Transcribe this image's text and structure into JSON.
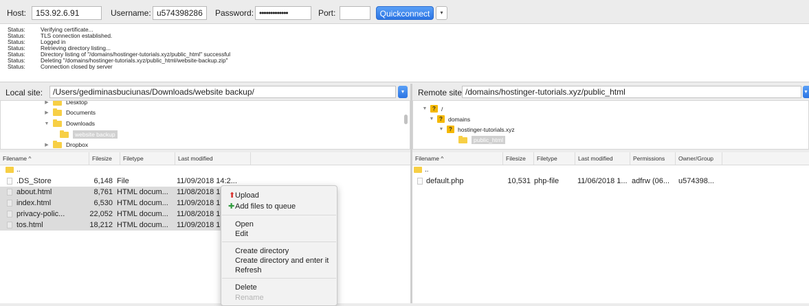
{
  "quickconnect": {
    "host_label": "Host:",
    "host_value": "153.92.6.91",
    "username_label": "Username:",
    "username_value": "u574398286",
    "password_label": "Password:",
    "password_value": "•••••••••••••",
    "port_label": "Port:",
    "port_value": "",
    "button_label": "Quickconnect",
    "dropdown_icon": "▾"
  },
  "log": [
    {
      "label": "Status:",
      "text": "Verifying certificate..."
    },
    {
      "label": "Status:",
      "text": "TLS connection established."
    },
    {
      "label": "Status:",
      "text": "Logged in"
    },
    {
      "label": "Status:",
      "text": "Retrieving directory listing..."
    },
    {
      "label": "Status:",
      "text": "Directory listing of \"/domains/hostinger-tutorials.xyz/public_html\" successful"
    },
    {
      "label": "Status:",
      "text": "Deleting \"/domains/hostinger-tutorials.xyz/public_html/website-backup.zip\""
    },
    {
      "label": "Status:",
      "text": "Connection closed by server"
    }
  ],
  "local": {
    "site_label": "Local site:",
    "site_path": "/Users/gediminasbuciunas/Downloads/website backup/",
    "tree": [
      {
        "label": "Desktop",
        "expanded": false
      },
      {
        "label": "Documents",
        "expanded": false
      },
      {
        "label": "Downloads",
        "expanded": true
      },
      {
        "label": "website backup",
        "expanded": false
      },
      {
        "label": "Dropbox",
        "expanded": false
      }
    ],
    "columns": {
      "filename": "Filename ^",
      "filesize": "Filesize",
      "filetype": "Filetype",
      "modified": "Last modified"
    },
    "parent": "..",
    "files": [
      {
        "name": ".DS_Store",
        "size": "6,148",
        "type": "File",
        "modified": "11/09/2018 14:2..."
      },
      {
        "name": "about.html",
        "size": "8,761",
        "type": "HTML docum...",
        "modified": "11/08/2018 19"
      },
      {
        "name": "index.html",
        "size": "6,530",
        "type": "HTML docum...",
        "modified": "11/09/2018 13"
      },
      {
        "name": "privacy-polic...",
        "size": "22,052",
        "type": "HTML docum...",
        "modified": "11/08/2018 19"
      },
      {
        "name": "tos.html",
        "size": "18,212",
        "type": "HTML docum...",
        "modified": "11/09/2018 13"
      }
    ]
  },
  "remote": {
    "site_label": "Remote site:",
    "site_path": "/domains/hostinger-tutorials.xyz/public_html",
    "tree": [
      {
        "label": "/"
      },
      {
        "label": "domains"
      },
      {
        "label": "hostinger-tutorials.xyz"
      },
      {
        "label": "public_html"
      }
    ],
    "columns": {
      "filename": "Filename ^",
      "filesize": "Filesize",
      "filetype": "Filetype",
      "modified": "Last modified",
      "permissions": "Permissions",
      "owner": "Owner/Group"
    },
    "parent": "..",
    "files": [
      {
        "name": "default.php",
        "size": "10,531",
        "type": "php-file",
        "modified": "11/06/2018 1...",
        "permissions": "adfrw (06...",
        "owner": "u574398..."
      }
    ]
  },
  "context_menu": {
    "upload": "Upload",
    "add_to_queue": "Add files to queue",
    "open": "Open",
    "edit": "Edit",
    "create_directory": "Create directory",
    "create_directory_enter": "Create directory and enter it",
    "refresh": "Refresh",
    "delete": "Delete",
    "rename": "Rename"
  },
  "colors": {
    "accent": "#2b74e3",
    "folder": "#f7cf45",
    "selection": "#dcdcdc"
  }
}
